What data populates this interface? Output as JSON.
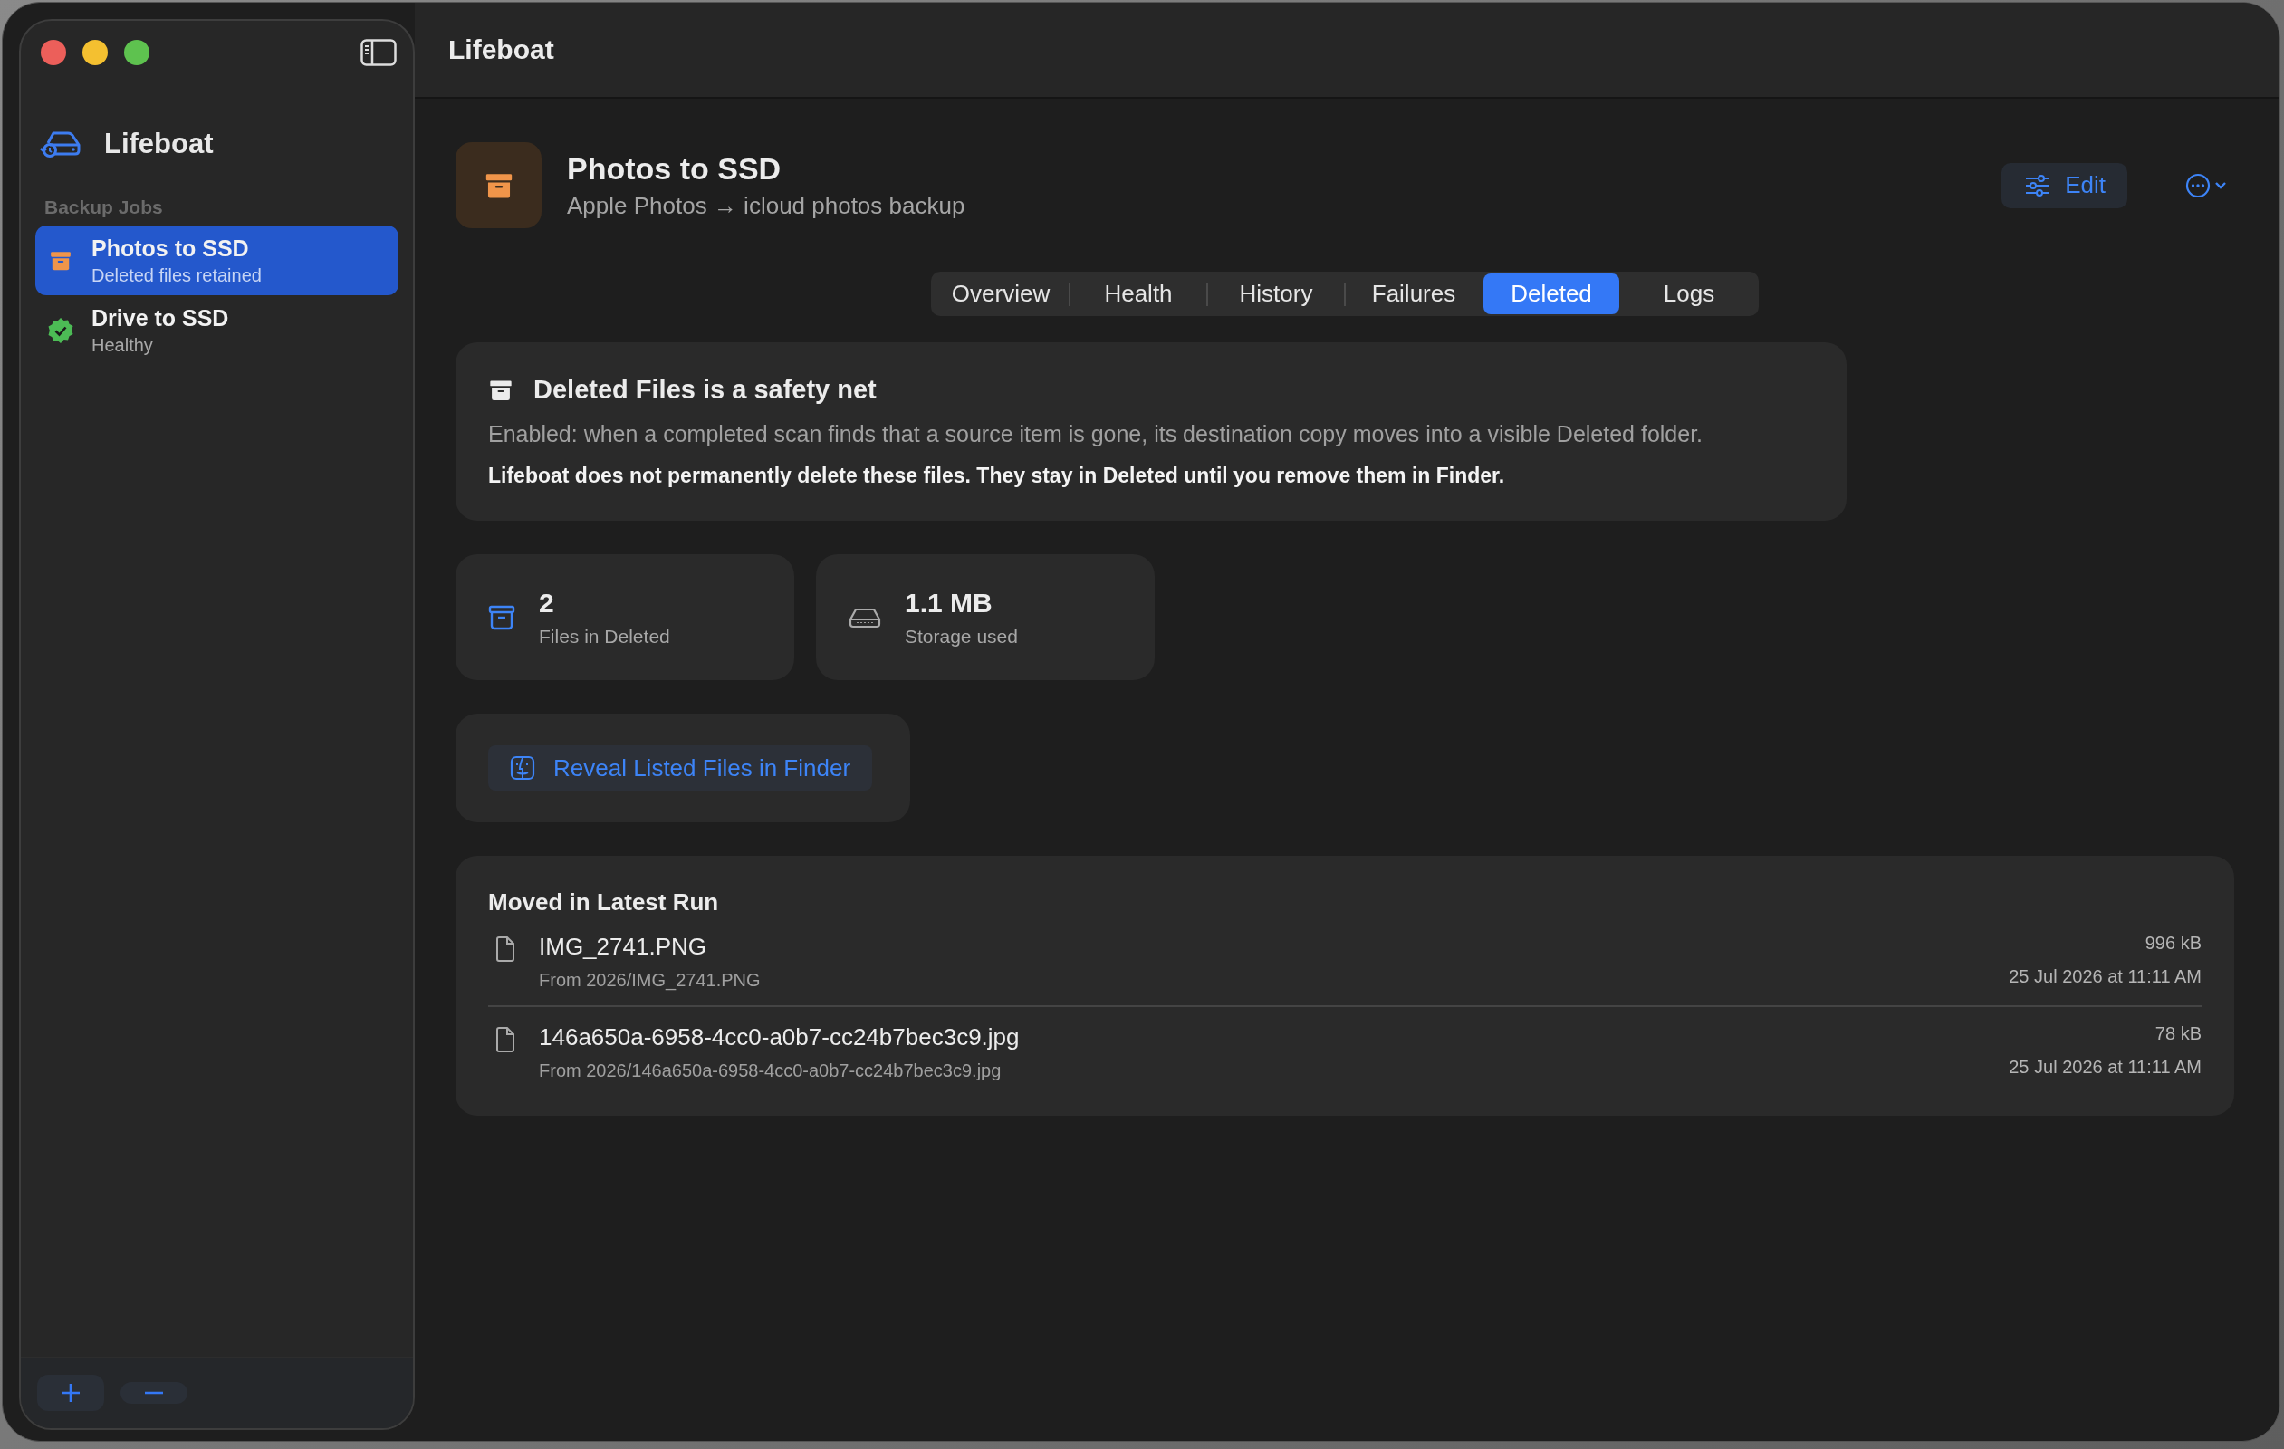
{
  "window": {
    "title": "Lifeboat"
  },
  "sidebar": {
    "app_name": "Lifeboat",
    "section": "Backup Jobs",
    "items": [
      {
        "name": "Photos to SSD",
        "status": "Deleted files retained",
        "kind": "archive",
        "selected": true
      },
      {
        "name": "Drive to SSD",
        "status": "Healthy",
        "kind": "healthy",
        "selected": false
      }
    ]
  },
  "job": {
    "title": "Photos to SSD",
    "subtitle": "Apple Photos → icloud photos backup",
    "edit_label": "Edit"
  },
  "tabs": [
    {
      "label": "Overview",
      "selected": false
    },
    {
      "label": "Health",
      "selected": false
    },
    {
      "label": "History",
      "selected": false
    },
    {
      "label": "Failures",
      "selected": false
    },
    {
      "label": "Deleted",
      "selected": true
    },
    {
      "label": "Logs",
      "selected": false
    }
  ],
  "notice": {
    "title": "Deleted Files is a safety net",
    "body": "Enabled: when a completed scan finds that a source item is gone, its destination copy moves into a visible Deleted folder.",
    "emphasis": "Lifeboat does not permanently delete these files. They stay in Deleted until you remove them in Finder."
  },
  "stats": [
    {
      "kind": "files",
      "value": "2",
      "label": "Files in Deleted"
    },
    {
      "kind": "storage",
      "value": "1.1 MB",
      "label": "Storage used"
    }
  ],
  "reveal_button": "Reveal Listed Files in Finder",
  "moved": {
    "title": "Moved in Latest Run",
    "files": [
      {
        "name": "IMG_2741.PNG",
        "path": "From 2026/IMG_2741.PNG",
        "size": "996 kB",
        "date": "25 Jul 2026 at 11:11 AM"
      },
      {
        "name": "146a650a-6958-4cc0-a0b7-cc24b7bec3c9.jpg",
        "path": "From 2026/146a650a-6958-4cc0-a0b7-cc24b7bec3c9.jpg",
        "size": "78 kB",
        "date": "25 Jul 2026 at 11:11 AM"
      }
    ]
  }
}
